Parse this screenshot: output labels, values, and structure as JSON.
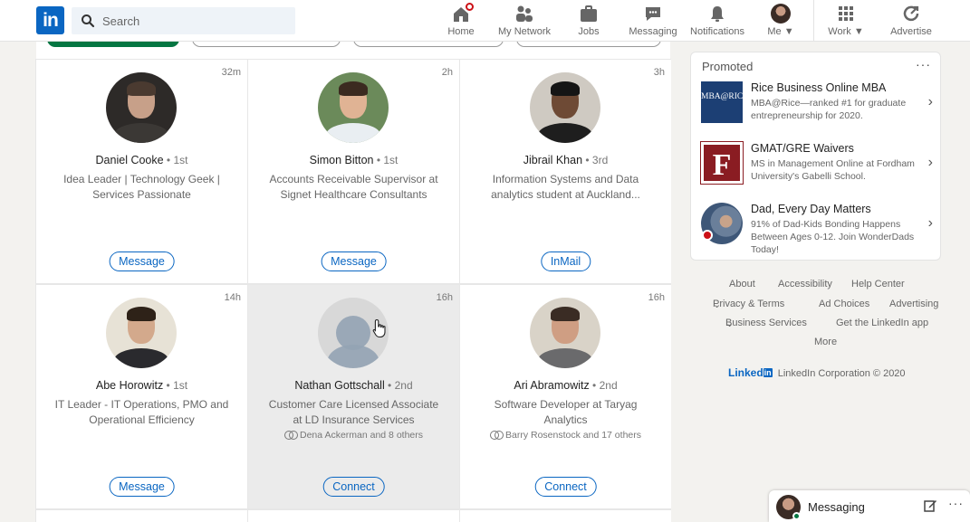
{
  "nav": {
    "logo_text": "in",
    "search_placeholder": "Search",
    "items": [
      {
        "label": "Home",
        "icon": "home-icon"
      },
      {
        "label": "My Network",
        "icon": "network-icon"
      },
      {
        "label": "Jobs",
        "icon": "briefcase-icon"
      },
      {
        "label": "Messaging",
        "icon": "chat-icon"
      },
      {
        "label": "Notifications",
        "icon": "bell-icon"
      },
      {
        "label": "Me",
        "icon": "avatar"
      },
      {
        "label": "Work",
        "icon": "grid-icon"
      },
      {
        "label": "Advertise",
        "icon": "advertise-icon"
      }
    ]
  },
  "cards": [
    {
      "time": "32m",
      "name": "Daniel Cooke",
      "degree": "1st",
      "title": "Idea Leader | Technology Geek | Services Passionate",
      "mutual": "",
      "button": "Message"
    },
    {
      "time": "2h",
      "name": "Simon Bitton",
      "degree": "1st",
      "title": "Accounts Receivable Supervisor at Signet Healthcare Consultants",
      "mutual": "",
      "button": "Message"
    },
    {
      "time": "3h",
      "name": "Jibrail Khan",
      "degree": "3rd",
      "title": "Information Systems and Data analytics student at Auckland...",
      "mutual": "",
      "button": "InMail"
    },
    {
      "time": "14h",
      "name": "Abe Horowitz",
      "degree": "1st",
      "title": "IT Leader - IT Operations, PMO and Operational Efficiency",
      "mutual": "",
      "button": "Message"
    },
    {
      "time": "16h",
      "name": "Nathan Gottschall",
      "degree": "2nd",
      "title": "Customer Care Licensed Associate at LD Insurance Services",
      "mutual": "Dena Ackerman and 8 others",
      "button": "Connect"
    },
    {
      "time": "16h",
      "name": "Ari Abramowitz",
      "degree": "2nd",
      "title": "Software Developer at Taryag Analytics",
      "mutual": "Barry Rosenstock and 17 others",
      "button": "Connect"
    }
  ],
  "promoted": {
    "title": "Promoted",
    "more": "···",
    "ads": [
      {
        "logo_text": "MBA@RICE",
        "headline": "Rice Business Online MBA",
        "body": "MBA@Rice—ranked #1 for graduate entrepreneurship for 2020."
      },
      {
        "logo_text": "F",
        "headline": "GMAT/GRE Waivers",
        "body": "MS in Management Online at Fordham University's Gabelli School."
      },
      {
        "logo_text": "",
        "headline": "Dad, Every Day Matters",
        "body": "91% of Dad-Kids Bonding Happens Between Ages 0-12. Join WonderDads Today!"
      }
    ]
  },
  "footer": {
    "about": "About",
    "accessibility": "Accessibility",
    "help": "Help Center",
    "privacy": "Privacy & Terms",
    "adchoices": "Ad Choices",
    "advertising": "Advertising",
    "business": "Business Services",
    "getapp": "Get the LinkedIn app",
    "more": "More",
    "brand_word": "Linked",
    "brand_in": "in",
    "copyright": "LinkedIn Corporation © 2020"
  },
  "messaging": {
    "label": "Messaging"
  },
  "colors": {
    "brand": "#0a66c2",
    "green": "#057642",
    "badge": "#cc1016"
  }
}
